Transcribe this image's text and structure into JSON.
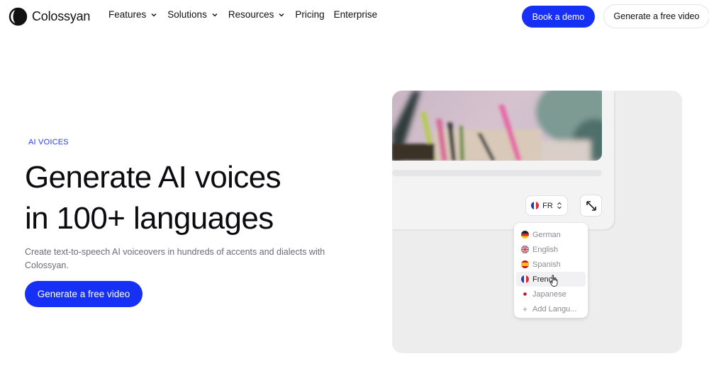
{
  "brand": {
    "name": "Colossyan"
  },
  "nav": {
    "items": [
      {
        "label": "Features",
        "has_dropdown": true
      },
      {
        "label": "Solutions",
        "has_dropdown": true
      },
      {
        "label": "Resources",
        "has_dropdown": true
      },
      {
        "label": "Pricing",
        "has_dropdown": false
      },
      {
        "label": "Enterprise",
        "has_dropdown": false
      }
    ],
    "book_demo_label": "Book a demo",
    "free_video_label": "Generate a free video"
  },
  "hero": {
    "eyebrow": "AI VOICES",
    "headline_line1": "Generate AI voices",
    "headline_line2": "in 100+ languages",
    "subtext": "Create text-to-speech AI voiceovers in hundreds of accents and dialects with Colossyan.",
    "cta_label": "Generate a free video"
  },
  "mockup": {
    "language_chip": {
      "code": "FR",
      "flag": "france-flag-icon"
    },
    "expand_icon": "expand-arrows-icon",
    "language_options": [
      {
        "label": "German",
        "flag": "germany-flag-icon",
        "selected": false
      },
      {
        "label": "English",
        "flag": "uk-flag-icon",
        "selected": false
      },
      {
        "label": "Spanish",
        "flag": "spain-flag-icon",
        "selected": false
      },
      {
        "label": "French",
        "flag": "france-flag-icon",
        "selected": true
      },
      {
        "label": "Japanese",
        "flag": "japan-flag-icon",
        "selected": false
      }
    ],
    "add_language_label": "Add Langu..."
  },
  "colors": {
    "accent": "#1730f5",
    "eyebrow": "#2a3df0",
    "mock_bg": "#ededee"
  }
}
